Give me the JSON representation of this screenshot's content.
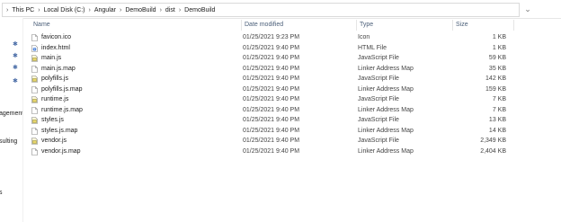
{
  "address": {
    "crumbs": [
      "This PC",
      "Local Disk (C:)",
      "Angular",
      "DemoBuild",
      "dist",
      "DemoBuild"
    ]
  },
  "sidebar": {
    "fragments": [
      "agement",
      "sulting",
      "s"
    ]
  },
  "columns": {
    "name": "Name",
    "date": "Date modified",
    "type": "Type",
    "size": "Size"
  },
  "files": [
    {
      "name": "favicon.ico",
      "date": "01/25/2021 9:23 PM",
      "type": "Icon",
      "size": "1 KB",
      "icon": "ico-file-icon"
    },
    {
      "name": "index.html",
      "date": "01/25/2021 9:40 PM",
      "type": "HTML File",
      "size": "1 KB",
      "icon": "html-file-icon"
    },
    {
      "name": "main.js",
      "date": "01/25/2021 9:40 PM",
      "type": "JavaScript File",
      "size": "59 KB",
      "icon": "js-file-icon"
    },
    {
      "name": "main.js.map",
      "date": "01/25/2021 9:40 PM",
      "type": "Linker Address Map",
      "size": "35 KB",
      "icon": "map-file-icon"
    },
    {
      "name": "polyfills.js",
      "date": "01/25/2021 9:40 PM",
      "type": "JavaScript File",
      "size": "142 KB",
      "icon": "js-file-icon"
    },
    {
      "name": "polyfills.js.map",
      "date": "01/25/2021 9:40 PM",
      "type": "Linker Address Map",
      "size": "159 KB",
      "icon": "map-file-icon"
    },
    {
      "name": "runtime.js",
      "date": "01/25/2021 9:40 PM",
      "type": "JavaScript File",
      "size": "7 KB",
      "icon": "js-file-icon"
    },
    {
      "name": "runtime.js.map",
      "date": "01/25/2021 9:40 PM",
      "type": "Linker Address Map",
      "size": "7 KB",
      "icon": "map-file-icon"
    },
    {
      "name": "styles.js",
      "date": "01/25/2021 9:40 PM",
      "type": "JavaScript File",
      "size": "13 KB",
      "icon": "js-file-icon"
    },
    {
      "name": "styles.js.map",
      "date": "01/25/2021 9:40 PM",
      "type": "Linker Address Map",
      "size": "14 KB",
      "icon": "map-file-icon"
    },
    {
      "name": "vendor.js",
      "date": "01/25/2021 9:40 PM",
      "type": "JavaScript File",
      "size": "2,349 KB",
      "icon": "js-file-icon"
    },
    {
      "name": "vendor.js.map",
      "date": "01/25/2021 9:40 PM",
      "type": "Linker Address Map",
      "size": "2,404 KB",
      "icon": "map-file-icon"
    }
  ],
  "colors": {
    "header_text": "#4c607a",
    "pin": "#4a6da7"
  }
}
